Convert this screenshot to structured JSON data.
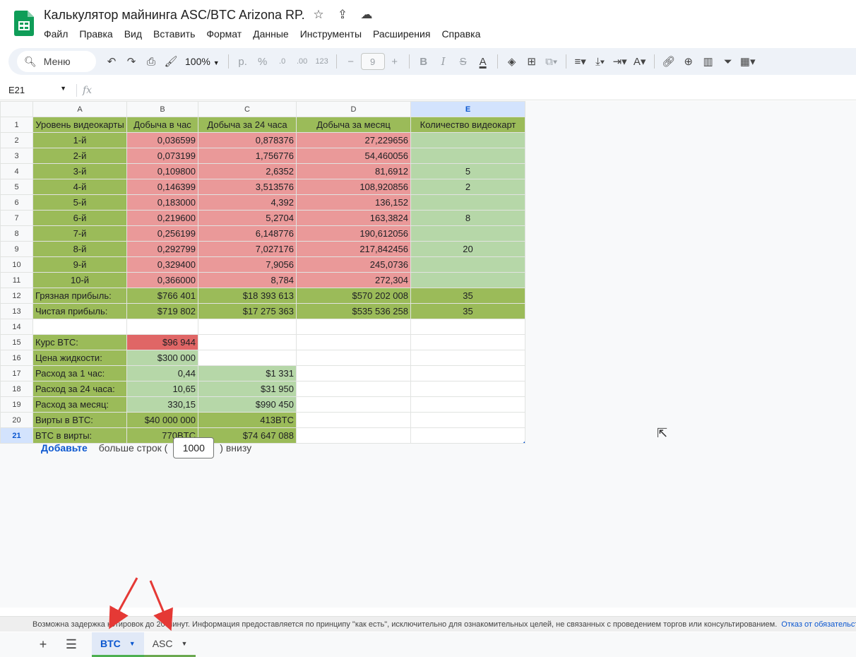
{
  "app": {
    "title": "Калькулятор майнинга ASC/BTC Arizona RP.",
    "menu": [
      "Файл",
      "Правка",
      "Вид",
      "Вставить",
      "Формат",
      "Данные",
      "Инструменты",
      "Расширения",
      "Справка"
    ],
    "brand_color": "#0f9d58"
  },
  "toolbar": {
    "search_label": "Меню",
    "zoom": "100%",
    "font_size": "9",
    "percent": "%",
    "currency": "р.",
    "dec_down": ".0",
    "dec_up": ".00",
    "number_format": "123"
  },
  "formula": {
    "cell_ref": "E21",
    "fx": "fx",
    "value": ""
  },
  "sheet": {
    "columns": [
      "A",
      "B",
      "C",
      "D",
      "E"
    ],
    "selected_column": "E",
    "selected_row": "21",
    "rows": [
      {
        "n": "1",
        "cells": [
          "Уровень видеокарты",
          "Добыча в час",
          "Добыча за 24 часа",
          "Добыча за месяц",
          "Количество видеокарт"
        ]
      },
      {
        "n": "2",
        "cells": [
          "1-й",
          "0,036599",
          "0,878376",
          "27,229656",
          ""
        ]
      },
      {
        "n": "3",
        "cells": [
          "2-й",
          "0,073199",
          "1,756776",
          "54,460056",
          ""
        ]
      },
      {
        "n": "4",
        "cells": [
          "3-й",
          "0,109800",
          "2,6352",
          "81,6912",
          "5"
        ]
      },
      {
        "n": "5",
        "cells": [
          "4-й",
          "0,146399",
          "3,513576",
          "108,920856",
          "2"
        ]
      },
      {
        "n": "6",
        "cells": [
          "5-й",
          "0,183000",
          "4,392",
          "136,152",
          ""
        ]
      },
      {
        "n": "7",
        "cells": [
          "6-й",
          "0,219600",
          "5,2704",
          "163,3824",
          "8"
        ]
      },
      {
        "n": "8",
        "cells": [
          "7-й",
          "0,256199",
          "6,148776",
          "190,612056",
          ""
        ]
      },
      {
        "n": "9",
        "cells": [
          "8-й",
          "0,292799",
          "7,027176",
          "217,842456",
          "20"
        ]
      },
      {
        "n": "10",
        "cells": [
          "9-й",
          "0,329400",
          "7,9056",
          "245,0736",
          ""
        ]
      },
      {
        "n": "11",
        "cells": [
          "10-й",
          "0,366000",
          "8,784",
          "272,304",
          ""
        ]
      },
      {
        "n": "12",
        "cells": [
          "Грязная прибыль:",
          "$766 401",
          "$18 393 613",
          "$570 202 008",
          "35"
        ]
      },
      {
        "n": "13",
        "cells": [
          "Чистая прибыль:",
          "$719 802",
          "$17 275 363",
          "$535 536 258",
          "35"
        ]
      },
      {
        "n": "14",
        "cells": [
          "",
          "",
          "",
          "",
          ""
        ]
      },
      {
        "n": "15",
        "cells": [
          "Курс BTC:",
          "$96 944",
          "",
          "",
          ""
        ]
      },
      {
        "n": "16",
        "cells": [
          "Цена жидкости:",
          "$300 000",
          "",
          "",
          ""
        ]
      },
      {
        "n": "17",
        "cells": [
          "Расход за 1 час:",
          "0,44",
          "$1 331",
          "",
          ""
        ]
      },
      {
        "n": "18",
        "cells": [
          "Расход за 24 часа:",
          "10,65",
          "$31 950",
          "",
          ""
        ]
      },
      {
        "n": "19",
        "cells": [
          "Расход за месяц:",
          "330,15",
          "$990 450",
          "",
          ""
        ]
      },
      {
        "n": "20",
        "cells": [
          "Вирты в BTC:",
          "$40 000 000",
          "413BTC",
          "",
          ""
        ]
      },
      {
        "n": "21",
        "cells": [
          "BTC в вирты:",
          "770BTC",
          "$74 647 088",
          "",
          ""
        ]
      }
    ]
  },
  "add_rows": {
    "link": "Добавьте",
    "text_before": "больше строк (",
    "count": "1000",
    "text_after": ") внизу"
  },
  "disclaimer": {
    "text": "Возможна задержка котировок до 20 минут. Информация предоставляется по принципу \"как есть\", исключительно для ознакомительных целей, не связанных с проведением торгов или консультированием.",
    "link": "Отказ от обязательств"
  },
  "tabs": [
    {
      "label": "BTC",
      "active": true
    },
    {
      "label": "ASC",
      "active": false
    }
  ],
  "annotation_color": "#e53935"
}
